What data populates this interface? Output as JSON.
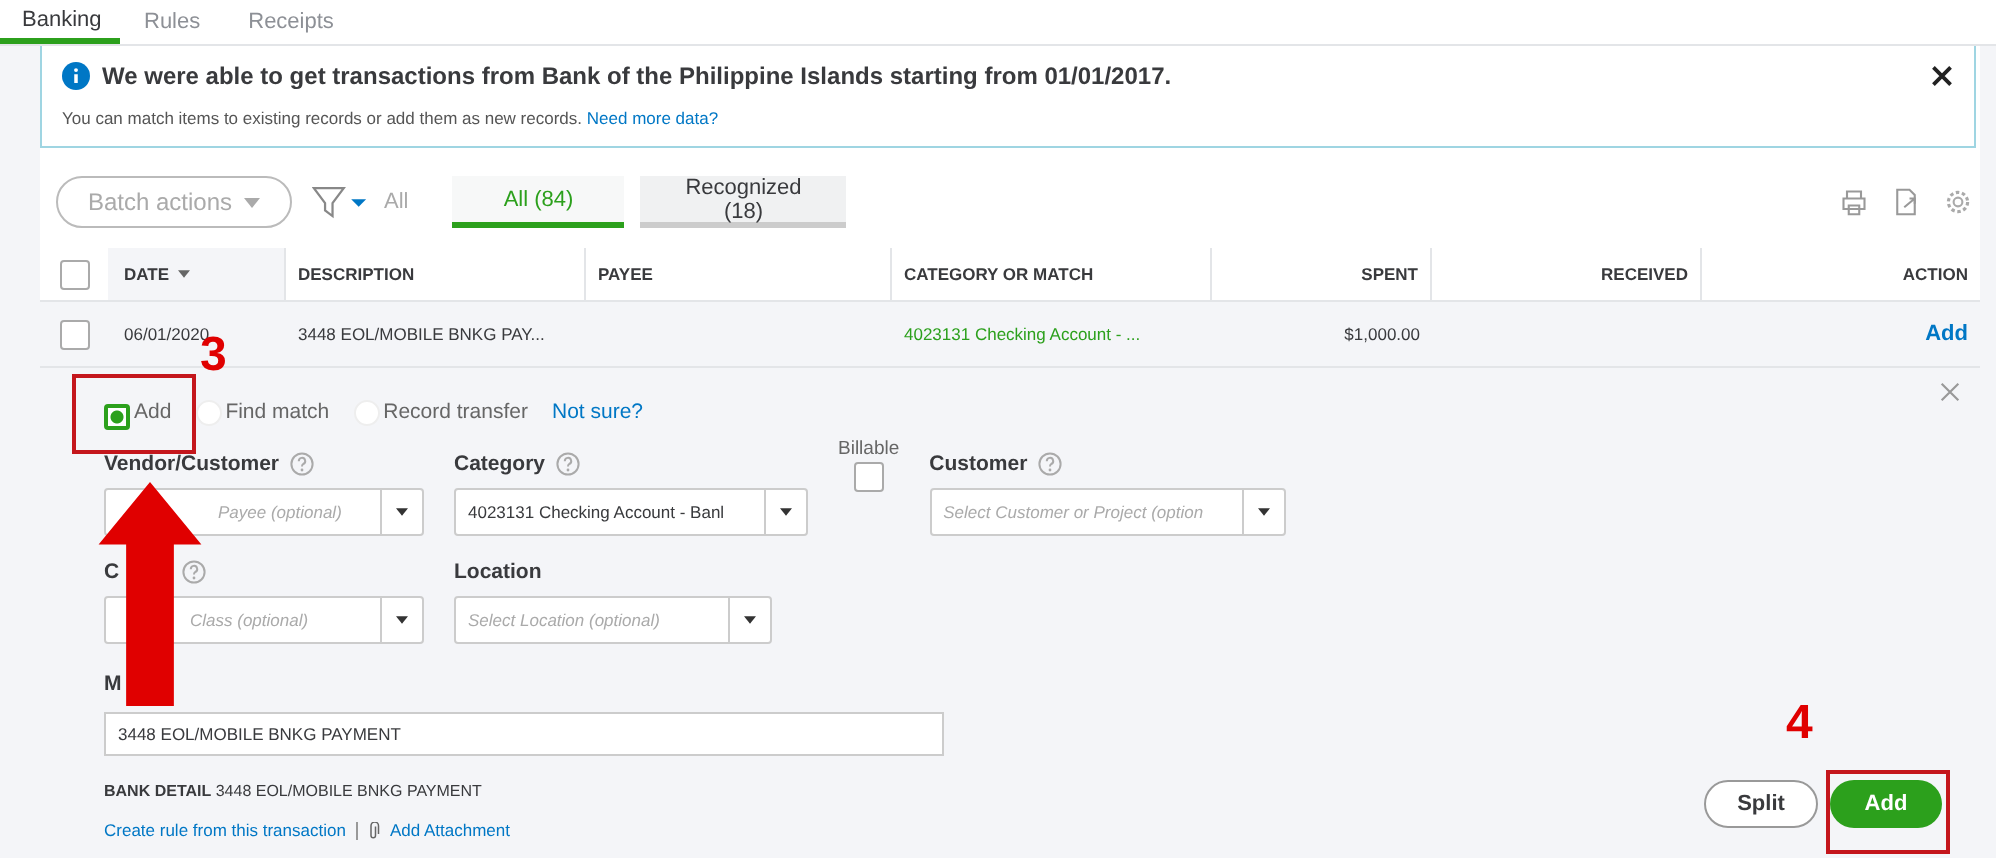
{
  "tabs": [
    {
      "label": "Banking",
      "selected": true
    },
    {
      "label": "Rules",
      "selected": false
    },
    {
      "label": "Receipts",
      "selected": false
    }
  ],
  "banner": {
    "message": "We were able to get transactions from Bank of the Philippine Islands starting from 01/01/2017.",
    "subtext": "You can match items to existing records or add them as new records.",
    "link": "Need more data?"
  },
  "toolbar": {
    "batch_actions": "Batch actions",
    "filter_label": "All",
    "filter_tabs": [
      {
        "label": "All (84)",
        "selected": true
      },
      {
        "label": "Recognized (18)",
        "selected": false
      }
    ]
  },
  "table": {
    "all_checked": false,
    "columns": [
      {
        "label": "DATE"
      },
      {
        "label": "DESCRIPTION"
      },
      {
        "label": "PAYEE"
      },
      {
        "label": "CATEGORY OR MATCH"
      },
      {
        "label": "SPENT"
      },
      {
        "label": "RECEIVED"
      },
      {
        "label": "ACTION"
      }
    ],
    "rows": [
      {
        "checked": false,
        "date": "06/01/2020",
        "description": "3448 EOL/MOBILE BNKG PAY...",
        "category": "4023131 Checking Account - ...",
        "spent": "$1,000.00",
        "action": "Add"
      }
    ]
  },
  "panel": {
    "options": [
      {
        "label": "Add",
        "selected": true
      },
      {
        "label": "Find match",
        "selected": false
      },
      {
        "label": "Record transfer",
        "selected": false
      }
    ],
    "not_sure": "Not sure?",
    "row1": [
      {
        "kind": "select",
        "label": "Vendor/Customer",
        "help": true,
        "placeholder": "Payee (optional)"
      },
      {
        "kind": "select",
        "label": "Category",
        "help": true,
        "value": "4023131 Checking Account - Banl"
      },
      {
        "kind": "checkbox",
        "label": "Billable",
        "checked": false
      },
      {
        "kind": "select",
        "label": "Customer",
        "help": true,
        "placeholder": "Select Customer or Project (option"
      }
    ],
    "row2": [
      {
        "kind": "select",
        "label": "C",
        "help": true,
        "placeholder": "Class (optional)"
      },
      {
        "kind": "select",
        "label": "Location",
        "placeholder": "Select Location (optional)"
      }
    ],
    "memo": {
      "label": "M",
      "value": "3448 EOL/MOBILE BNKG PAYMENT"
    },
    "bank_detail": {
      "label": "BANK DETAIL",
      "text": "3448 EOL/MOBILE BNKG PAYMENT"
    },
    "links": [
      "Create rule from this transaction",
      "Add Attachment"
    ],
    "buttons": [
      {
        "label": "Split",
        "kind": "secondary"
      },
      {
        "label": "Add",
        "kind": "primary"
      }
    ]
  },
  "annotations": [
    "3",
    "4"
  ]
}
